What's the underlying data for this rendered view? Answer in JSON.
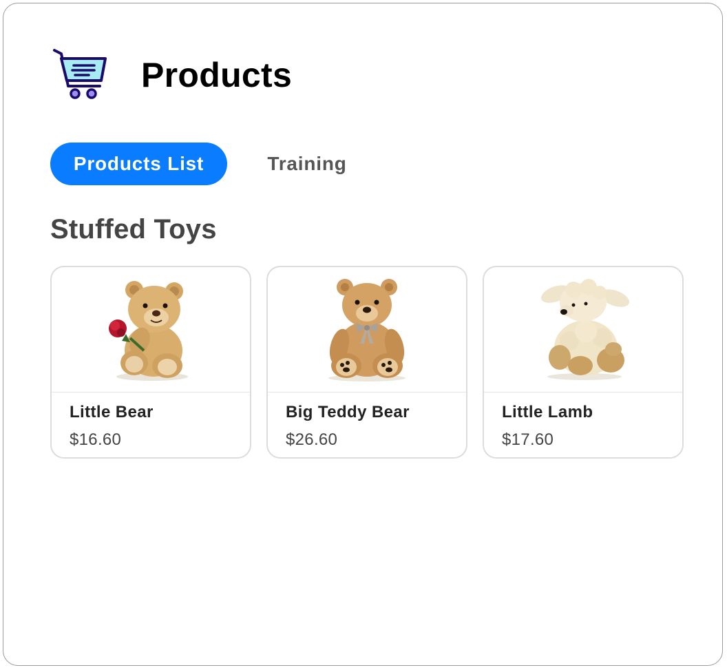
{
  "header": {
    "title": "Products",
    "icon": "shopping-cart-icon"
  },
  "tabs": [
    {
      "label": "Products List",
      "active": true
    },
    {
      "label": "Training",
      "active": false
    }
  ],
  "section": {
    "title": "Stuffed Toys"
  },
  "products": [
    {
      "name": "Little Bear",
      "price": "$16.60",
      "image": "teddy-bear-with-rose"
    },
    {
      "name": "Big Teddy Bear",
      "price": "$26.60",
      "image": "teddy-bear-with-ribbon"
    },
    {
      "name": "Little Lamb",
      "price": "$17.60",
      "image": "plush-lamb"
    }
  ],
  "colors": {
    "accent": "#0a7cff",
    "cart_fill": "#a6ecf2",
    "cart_stroke": "#1a0a6b"
  }
}
